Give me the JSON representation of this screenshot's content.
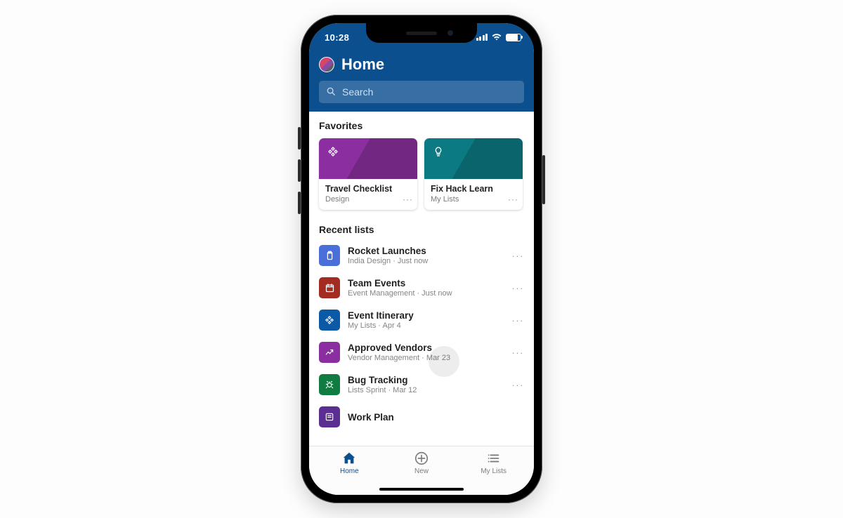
{
  "status": {
    "time": "10:28"
  },
  "header": {
    "title": "Home",
    "search_placeholder": "Search"
  },
  "favorites": {
    "section_label": "Favorites",
    "cards": [
      {
        "name": "Travel Checklist",
        "subtitle": "Design",
        "color": "#8b2fa0",
        "icon": "waypoint-icon"
      },
      {
        "name": "Fix Hack Learn",
        "subtitle": "My Lists",
        "color": "#0c7a82",
        "icon": "lightbulb-icon"
      }
    ]
  },
  "recent": {
    "section_label": "Recent lists",
    "items": [
      {
        "name": "Rocket Launches",
        "subtitle": "India Design · Just now",
        "color": "#4b6fd8",
        "icon": "clipboard-icon"
      },
      {
        "name": "Team Events",
        "subtitle": "Event Management · Just now",
        "color": "#a42b22",
        "icon": "calendar-icon"
      },
      {
        "name": "Event Itinerary",
        "subtitle": "My Lists · Apr 4",
        "color": "#0c5aa6",
        "icon": "waypoint-icon"
      },
      {
        "name": "Approved Vendors",
        "subtitle": "Vendor Management · Mar 23",
        "color": "#8b2fa0",
        "icon": "trend-icon"
      },
      {
        "name": "Bug Tracking",
        "subtitle": "Lists Sprint · Mar 12",
        "color": "#107c41",
        "icon": "bug-icon"
      },
      {
        "name": "Work Plan",
        "subtitle": "",
        "color": "#5b2e91",
        "icon": "plan-icon"
      }
    ]
  },
  "tabs": {
    "home": "Home",
    "new": "New",
    "mylists": "My Lists"
  }
}
